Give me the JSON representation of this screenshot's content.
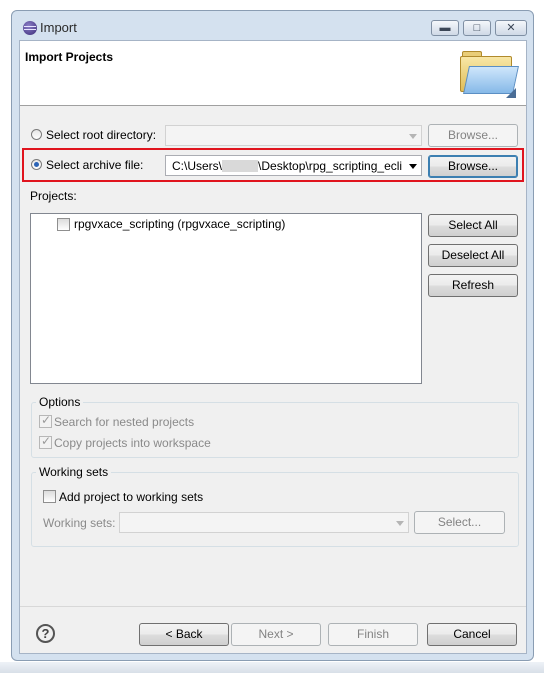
{
  "window": {
    "title": "Import",
    "min_icon": "minimize-icon",
    "max_icon": "maximize-icon",
    "close_icon": "close-icon"
  },
  "header": {
    "title": "Import Projects",
    "icon": "open-folder-icon"
  },
  "source": {
    "root_directory_label": "Select root directory:",
    "root_directory_value": "",
    "root_browse": "Browse...",
    "archive_label": "Select archive file:",
    "archive_value": "C:\\Users\\",
    "archive_value_tail": "\\Desktop\\rpg_scripting_eclip",
    "archive_browse": "Browse..."
  },
  "projects": {
    "label": "Projects:",
    "items": [
      {
        "label": "rpgvxace_scripting (rpgvxace_scripting)",
        "checked": false
      }
    ],
    "select_all": "Select All",
    "deselect_all": "Deselect All",
    "refresh": "Refresh"
  },
  "options": {
    "title": "Options",
    "nested": "Search for nested projects",
    "copy": "Copy projects into workspace"
  },
  "working_sets": {
    "title": "Working sets",
    "add": "Add project to working sets",
    "sets_label": "Working sets:",
    "sets_value": "",
    "select": "Select..."
  },
  "footer": {
    "help": "?",
    "back": "< Back",
    "next": "Next >",
    "finish": "Finish",
    "cancel": "Cancel"
  },
  "colors": {
    "highlight": "#e0141e",
    "accent": "#2b63b6"
  }
}
